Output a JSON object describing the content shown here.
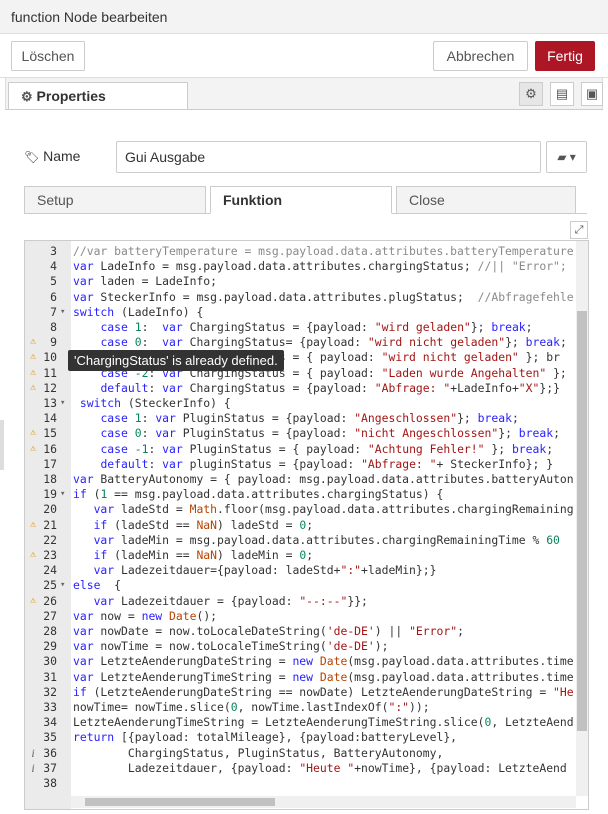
{
  "dialog": {
    "title": "function Node bearbeiten",
    "delete_label": "Löschen",
    "cancel_label": "Abbrechen",
    "done_label": "Fertig"
  },
  "tabs": {
    "properties_label": "Properties"
  },
  "name_field": {
    "label": "Name",
    "value": "Gui Ausgabe"
  },
  "subtabs": [
    "Setup",
    "Funktion",
    "Close"
  ],
  "tooltip": "'ChargingStatus' is already defined.",
  "code_lines": [
    {
      "n": "3",
      "fold": "",
      "ann": "",
      "text": "//var batteryTemperature = msg.payload.data.attributes.batteryTemperature"
    },
    {
      "n": "4",
      "fold": "",
      "ann": "",
      "text": "var LadeInfo = msg.payload.data.attributes.chargingStatus; //|| \"Error\";"
    },
    {
      "n": "5",
      "fold": "",
      "ann": "",
      "text": "var laden = LadeInfo;"
    },
    {
      "n": "6",
      "fold": "",
      "ann": "",
      "text": "var SteckerInfo = msg.payload.data.attributes.plugStatus;  //Abfragefehle"
    },
    {
      "n": "7",
      "fold": "▾",
      "ann": "",
      "text": "switch (LadeInfo) {"
    },
    {
      "n": "8",
      "fold": "",
      "ann": "",
      "text": "    case 1:  var ChargingStatus = {payload: \"wird geladen\"}; break;"
    },
    {
      "n": "9",
      "fold": "",
      "ann": "warn",
      "text": "    case 0:  var ChargingStatus= {payload: \"wird nicht geladen\"}; break;"
    },
    {
      "n": "10",
      "fold": "",
      "ann": "warn",
      "text": "    case -1: var ChargingStatus = { payload: \"wird nicht geladen\" }; br"
    },
    {
      "n": "11",
      "fold": "",
      "ann": "warn",
      "text": "    case -2: var ChargingStatus = { payload: \"Laden wurde Angehalten\" };"
    },
    {
      "n": "12",
      "fold": "",
      "ann": "warn",
      "text": "    default: var ChargingStatus = {payload: \"Abfrage: \"+LadeInfo+\"X\"};}"
    },
    {
      "n": "13",
      "fold": "▾",
      "ann": "",
      "text": " switch (SteckerInfo) {"
    },
    {
      "n": "14",
      "fold": "",
      "ann": "",
      "text": "    case 1: var PluginStatus = {payload: \"Angeschlossen\"}; break;"
    },
    {
      "n": "15",
      "fold": "",
      "ann": "warn",
      "text": "    case 0: var PluginStatus = {payload: \"nicht Angeschlossen\"}; break;"
    },
    {
      "n": "16",
      "fold": "",
      "ann": "warn",
      "text": "    case -1: var PluginStatus = { payload: \"Achtung Fehler!\" }; break;"
    },
    {
      "n": "17",
      "fold": "",
      "ann": "",
      "text": "    default: var pluginStatus = {payload: \"Abfrage: \"+ SteckerInfo}; }"
    },
    {
      "n": "18",
      "fold": "",
      "ann": "",
      "text": "var BatteryAutonomy = { payload: msg.payload.data.attributes.batteryAuton"
    },
    {
      "n": "19",
      "fold": "▾",
      "ann": "",
      "text": "if (1 == msg.payload.data.attributes.chargingStatus) {"
    },
    {
      "n": "20",
      "fold": "",
      "ann": "",
      "text": "   var ladeStd = Math.floor(msg.payload.data.attributes.chargingRemaining"
    },
    {
      "n": "21",
      "fold": "",
      "ann": "warn",
      "text": "   if (ladeStd == NaN) ladeStd = 0;"
    },
    {
      "n": "22",
      "fold": "",
      "ann": "",
      "text": "   var ladeMin = msg.payload.data.attributes.chargingRemainingTime % 60"
    },
    {
      "n": "23",
      "fold": "",
      "ann": "warn",
      "text": "   if (ladeMin == NaN) ladeMin = 0;"
    },
    {
      "n": "24",
      "fold": "",
      "ann": "",
      "text": "   var Ladezeitdauer={payload: ladeStd+\":\"+ladeMin};}"
    },
    {
      "n": "25",
      "fold": "▾",
      "ann": "",
      "text": "else  {"
    },
    {
      "n": "26",
      "fold": "",
      "ann": "warn",
      "text": "   var Ladezeitdauer = {payload: \"--:--\"}};"
    },
    {
      "n": "27",
      "fold": "",
      "ann": "",
      "text": "var now = new Date();"
    },
    {
      "n": "28",
      "fold": "",
      "ann": "",
      "text": "var nowDate = now.toLocaleDateString('de-DE') || \"Error\";"
    },
    {
      "n": "29",
      "fold": "",
      "ann": "",
      "text": "var nowTime = now.toLocaleTimeString('de-DE');"
    },
    {
      "n": "30",
      "fold": "",
      "ann": "",
      "text": "var LetzteAenderungDateString = new Date(msg.payload.data.attributes.time"
    },
    {
      "n": "31",
      "fold": "",
      "ann": "",
      "text": "var LetzteAenderungTimeString = new Date(msg.payload.data.attributes.time"
    },
    {
      "n": "32",
      "fold": "",
      "ann": "",
      "text": "if (LetzteAenderungDateString == nowDate) LetzteAenderungDateString = \"He"
    },
    {
      "n": "33",
      "fold": "",
      "ann": "",
      "text": "nowTime= nowTime.slice(0, nowTime.lastIndexOf(\":\"));"
    },
    {
      "n": "34",
      "fold": "",
      "ann": "",
      "text": "LetzteAenderungTimeString = LetzteAenderungTimeString.slice(0, LetzteAend"
    },
    {
      "n": "35",
      "fold": "",
      "ann": "",
      "text": "return [{payload: totalMileage}, {payload:batteryLevel},"
    },
    {
      "n": "36",
      "fold": "",
      "ann": "info",
      "text": "        ChargingStatus, PluginStatus, BatteryAutonomy,"
    },
    {
      "n": "37",
      "fold": "",
      "ann": "info",
      "text": "        Ladezeitdauer, {payload: \"Heute \"+nowTime}, {payload: LetzteAend"
    },
    {
      "n": "38",
      "fold": "",
      "ann": "",
      "text": ""
    }
  ]
}
